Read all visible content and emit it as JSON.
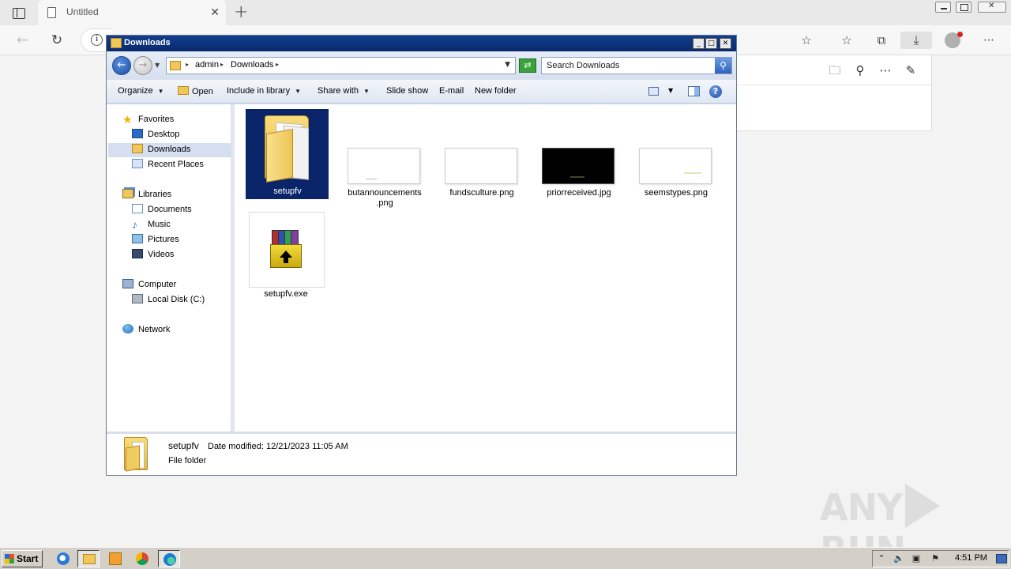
{
  "browser": {
    "tab_title": "Untitled",
    "new_tab_symbol": "+",
    "close_symbol": "✕"
  },
  "explorer": {
    "title": "Downloads",
    "breadcrumb": [
      "admin",
      "Downloads"
    ],
    "search_placeholder": "Search Downloads",
    "commands": {
      "organize": "Organize",
      "open": "Open",
      "include_in_library": "Include in library",
      "share_with": "Share with",
      "slide_show": "Slide show",
      "email": "E-mail",
      "new_folder": "New folder"
    },
    "nav_pane": {
      "favorites": "Favorites",
      "desktop": "Desktop",
      "downloads": "Downloads",
      "recent_places": "Recent Places",
      "libraries": "Libraries",
      "documents": "Documents",
      "music": "Music",
      "pictures": "Pictures",
      "videos": "Videos",
      "computer": "Computer",
      "local_disk": "Local Disk (C:)",
      "network": "Network"
    },
    "files": [
      {
        "name": "setupfv",
        "type": "folder",
        "selected": true
      },
      {
        "name_line1": "butannouncements",
        "name_line2": ".png",
        "type": "image"
      },
      {
        "name": "fundsculture.png",
        "type": "image"
      },
      {
        "name": "priorreceived.jpg",
        "type": "image-dark"
      },
      {
        "name": "seemstypes.png",
        "type": "image"
      },
      {
        "name": "setupfv.exe",
        "type": "winrar-exe"
      }
    ],
    "details": {
      "name": "setupfv",
      "date_modified": "Date modified: 12/21/2023 11:05 AM",
      "type": "File folder"
    }
  },
  "watermark": {
    "left": "ANY",
    "right": "RUN"
  },
  "taskbar": {
    "start_label": "Start",
    "clock": "4:51 PM"
  },
  "colors": {
    "title_bar": "#0a2a6e",
    "selection": "#0a246a",
    "taskbar": "#d4d0c8"
  }
}
